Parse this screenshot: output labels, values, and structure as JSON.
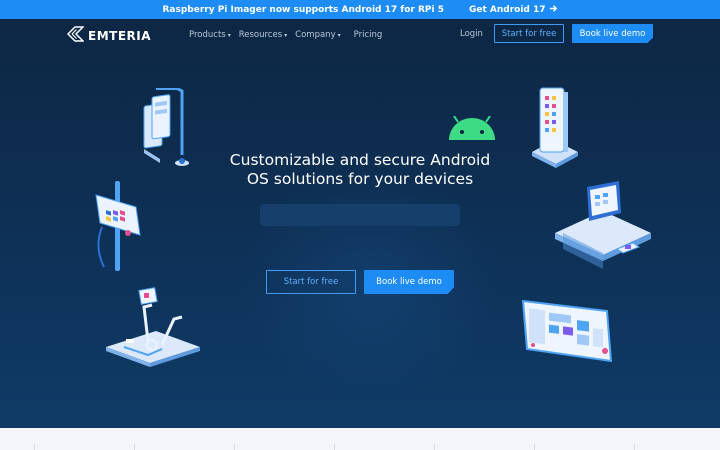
{
  "banner": {
    "text": "Raspberry Pi Imager now supports Android 17 for RPi 5",
    "cta_label": "Get Android 17",
    "cta_icon": "arrow-right-icon"
  },
  "nav": {
    "logo_text": "EMTERIA",
    "logo_icon": "emteria-logo-icon",
    "menu": [
      {
        "label": "Products",
        "has_dropdown": true
      },
      {
        "label": "Resources",
        "has_dropdown": true
      },
      {
        "label": "Company",
        "has_dropdown": true
      },
      {
        "label": "Pricing",
        "has_dropdown": false
      }
    ],
    "login_label": "Login",
    "start_label": "Start for free",
    "demo_label": "Book live demo"
  },
  "hero": {
    "headline_line1": "Customizable and secure Android",
    "headline_line2": "OS solutions for your devices",
    "start_label": "Start for free",
    "demo_label": "Book live demo"
  },
  "colors": {
    "banner": "#1e8cf5",
    "hero_bg": "#0d2744",
    "accent": "#1e8cf5",
    "android_green": "#3ddc84"
  }
}
